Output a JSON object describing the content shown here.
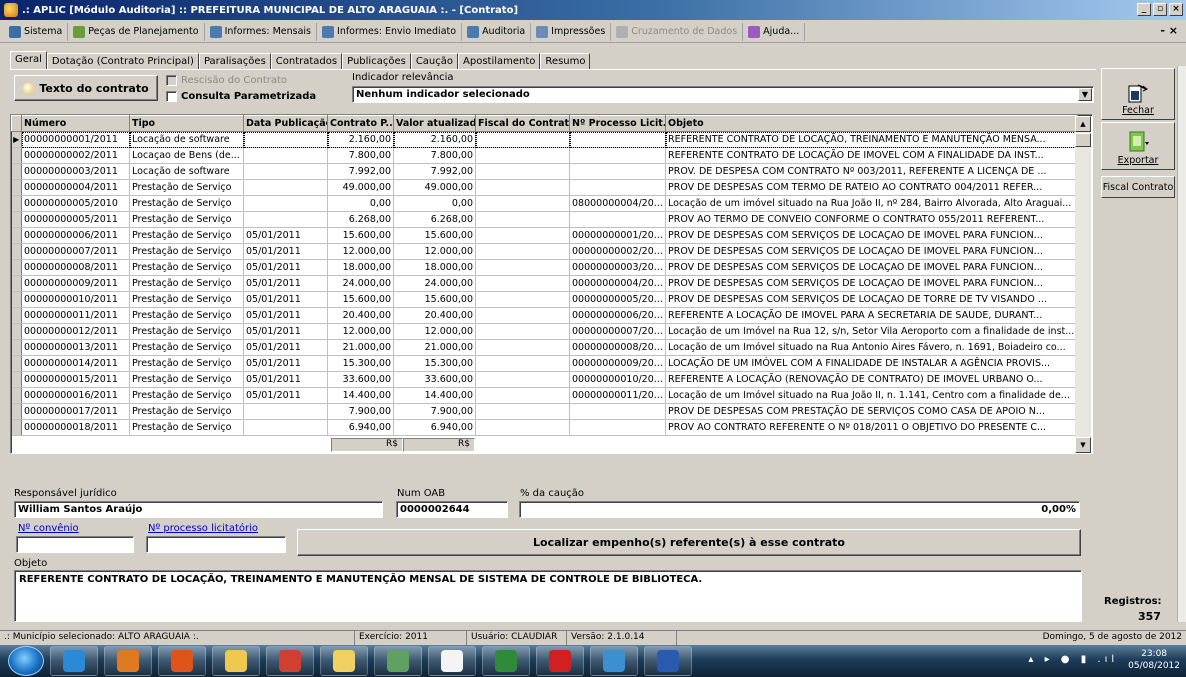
{
  "window": {
    "title": ".: APLIC [Módulo Auditoria] :: PREFEITURA MUNICIPAL DE ALTO ARAGUAIA :. - [Contrato]",
    "min": "_",
    "max": "▫",
    "close": "×"
  },
  "menu": [
    {
      "label": "Sistema",
      "icon": "system-icon",
      "color": "#3a6ea5"
    },
    {
      "label": "Peças de Planejamento",
      "icon": "planning-icon",
      "color": "#6a9a3a"
    },
    {
      "label": "Informes: Mensais",
      "icon": "report-icon",
      "color": "#4a7ab0"
    },
    {
      "label": "Informes: Envio Imediato",
      "icon": "report-icon",
      "color": "#4a7ab0"
    },
    {
      "label": "Auditoria",
      "icon": "audit-icon",
      "color": "#4a7ab0"
    },
    {
      "label": "Impressões",
      "icon": "printer-icon",
      "color": "#6a8ab8"
    },
    {
      "label": "Cruzamento de Dados",
      "icon": "data-cross-icon",
      "color": "#b0b0b0",
      "disabled": true
    },
    {
      "label": "Ajuda...",
      "icon": "help-icon",
      "color": "#9a5ac0"
    }
  ],
  "mdi_close": "- ×",
  "tabs": [
    "Geral",
    "Dotação (Contrato Principal)",
    "Paralisações",
    "Contratados",
    "Publicações",
    "Caução",
    "Apostilamento",
    "Resumo"
  ],
  "top": {
    "texto_button": "Texto do contrato",
    "rescisao_label": "Rescisão do Contrato",
    "consulta_label": "Consulta Parametrizada",
    "indicador_label": "Indicador relevância",
    "indicador_value": "Nenhum indicador selecionado"
  },
  "grid": {
    "columns": [
      "Número",
      "Tipo",
      "Data Publicação",
      "Contrato P...",
      "Valor atualizado",
      "Fiscal do Contrato",
      "Nº Processo Licit...",
      "Objeto"
    ],
    "rows": [
      [
        "00000000001/2011",
        "Locação de software",
        "",
        "2.160,00",
        "2.160,00",
        "",
        "",
        "REFERENTE CONTRATO DE LOCAÇÃO, TREINAMENTO E MANUTENÇÃO MENSA..."
      ],
      [
        "00000000002/2011",
        "Locaçao de Bens (de...",
        "",
        "7.800,00",
        "7.800,00",
        "",
        "",
        "REFERENTE CONTRATO DE LOCAÇÃO DE IMOVEL COM A FINALIDADE DA INST..."
      ],
      [
        "00000000003/2011",
        "Locação de software",
        "",
        "7.992,00",
        "7.992,00",
        "",
        "",
        "PROV. DE DESPESA COM CONTRATO Nº 003/2011, REFERENTE A LICENÇA DE ..."
      ],
      [
        "00000000004/2011",
        "Prestação de Serviço",
        "",
        "49.000,00",
        "49.000,00",
        "",
        "",
        "PROV DE DESPESAS COM TERMO DE RATEIO AO CONTRATO 004/2011 REFER..."
      ],
      [
        "00000000005/2010",
        "Prestação de Serviço",
        "",
        "0,00",
        "0,00",
        "",
        "08000000004/20...",
        "Locação de um imóvel situado na Rua João II, nº 284, Bairro Alvorada, Alto Araguai..."
      ],
      [
        "00000000005/2011",
        "Prestação de Serviço",
        "",
        "6.268,00",
        "6.268,00",
        "",
        "",
        "PROV AO TERMO DE CONVEIO CONFORME O CONTRATO 055/2011 REFERENT..."
      ],
      [
        "00000000006/2011",
        "Prestação de Serviço",
        "05/01/2011",
        "15.600,00",
        "15.600,00",
        "",
        "00000000001/20...",
        "PROV DE DESPESAS COM SERVIÇOS DE LOCAÇAO DE IMOVEL PARA FUNCION..."
      ],
      [
        "00000000007/2011",
        "Prestação de Serviço",
        "05/01/2011",
        "12.000,00",
        "12.000,00",
        "",
        "00000000002/20...",
        "PROV DE DESPESAS COM SERVIÇOS DE LOCAÇAO DE IMOVEL PARA FUNCION..."
      ],
      [
        "00000000008/2011",
        "Prestação de Serviço",
        "05/01/2011",
        "18.000,00",
        "18.000,00",
        "",
        "00000000003/20...",
        "PROV DE DESPESAS COM SERVIÇOS DE LOCAÇAO DE IMOVEL PARA FUNCION..."
      ],
      [
        "00000000009/2011",
        "Prestação de Serviço",
        "05/01/2011",
        "24.000,00",
        "24.000,00",
        "",
        "00000000004/20...",
        "PROV DE DESPESAS COM SERVIÇOS DE LOCAÇAO DE IMOVEL PARA FUNCION..."
      ],
      [
        "00000000010/2011",
        "Prestação de Serviço",
        "05/01/2011",
        "15.600,00",
        "15.600,00",
        "",
        "00000000005/20...",
        "PROV DE DESPESAS COM SERVIÇOS DE LOCAÇAO DE TORRE DE TV VISANDO ..."
      ],
      [
        "00000000011/2011",
        "Prestação de Serviço",
        "05/01/2011",
        "20.400,00",
        "20.400,00",
        "",
        "00000000006/20...",
        "REFERENTE A LOCAÇÃO DE IMOVEL PARA A SECRETARIA DE SAUDE, DURANT..."
      ],
      [
        "00000000012/2011",
        "Prestação de Serviço",
        "05/01/2011",
        "12.000,00",
        "12.000,00",
        "",
        "00000000007/20...",
        "Locação de um Imóvel na Rua 12, s/n, Setor Vila Aeroporto com a finalidade de inst..."
      ],
      [
        "00000000013/2011",
        "Prestação de Serviço",
        "05/01/2011",
        "21.000,00",
        "21.000,00",
        "",
        "00000000008/20...",
        "Locação de um Imóvel situado na Rua Antonio Aires Fávero, n. 1691, Boiadeiro co..."
      ],
      [
        "00000000014/2011",
        "Prestação de Serviço",
        "05/01/2011",
        "15.300,00",
        "15.300,00",
        "",
        "00000000009/20...",
        "LOCAÇÃO DE UM IMÓVEL COM A FINALIDADE DE INSTALAR A AGÊNCIA PROVIS..."
      ],
      [
        "00000000015/2011",
        "Prestação de Serviço",
        "05/01/2011",
        "33.600,00",
        "33.600,00",
        "",
        "00000000010/20...",
        "REFERENTE A LOCAÇÃO (RENOVAÇÃO DE CONTRATO) DE IMOVEL URBANO O..."
      ],
      [
        "00000000016/2011",
        "Prestação de Serviço",
        "05/01/2011",
        "14.400,00",
        "14.400,00",
        "",
        "00000000011/20...",
        "Locação de um Imóvel situado na Rua João II, n. 1.141, Centro com a finalidade de..."
      ],
      [
        "00000000017/2011",
        "Prestação de Serviço",
        "",
        "7.900,00",
        "7.900,00",
        "",
        "",
        "PROV DE DESPESAS COM PRESTAÇÃO DE SERVIÇOS COMO CASA DE APOIO N..."
      ],
      [
        "00000000018/2011",
        "Prestação de Serviço",
        "",
        "6.940,00",
        "6.940,00",
        "",
        "",
        "PROV AO CONTRATO REFERENTE O Nº 018/2011 O OBJETIVO DO PRESENTE C..."
      ]
    ],
    "total_contrato": "R$",
    "total_valor": "R$"
  },
  "right": {
    "fechar": "Fechar",
    "exportar": "Exportar",
    "fiscal": "Fiscal Contrato",
    "registros_label": "Registros:",
    "registros_value": "357"
  },
  "form": {
    "responsavel_label": "Responsável jurídico",
    "responsavel_value": "William Santos Araújo",
    "oab_label": "Num OAB",
    "oab_value": "0000002644",
    "caucao_label": "% da caução",
    "caucao_value": "0,00%",
    "convenio_label": "Nº convênio",
    "convenio_value": "",
    "processo_label": "Nº processo licitatório",
    "processo_value": "",
    "localizar_button": "Localizar empenho(s) referente(s) à esse contrato",
    "objeto_label": "Objeto",
    "objeto_value": "REFERENTE CONTRATO DE LOCAÇÃO, TREINAMENTO E MANUTENÇÃO MENSAL DE SISTEMA DE CONTROLE DE BIBLIOTECA."
  },
  "status": {
    "municipio": ".: Município selecionado: ALTO ARAGUAIA :.",
    "exercicio": "Exercício: 2011",
    "usuario": "Usuário: CLAUDIAR",
    "versao": "Versão: 2.1.0.14",
    "data": "Domingo, 5 de agosto de 2012"
  },
  "taskbar": {
    "apps": [
      {
        "name": "internet-explorer-icon",
        "color": "#2a8ad8"
      },
      {
        "name": "outlook-icon",
        "color": "#e07a20"
      },
      {
        "name": "firefox-icon",
        "color": "#e0541a"
      },
      {
        "name": "file-explorer-icon",
        "color": "#f0c850"
      },
      {
        "name": "chrome-icon",
        "color": "#d04030"
      },
      {
        "name": "folder-icon",
        "color": "#f0d060"
      },
      {
        "name": "tools-icon",
        "color": "#60a060"
      },
      {
        "name": "document-icon",
        "color": "#f4f4f4"
      },
      {
        "name": "excel-icon",
        "color": "#2f8a3a"
      },
      {
        "name": "pdf-icon",
        "color": "#d02020"
      },
      {
        "name": "globe-icon",
        "color": "#3a90d0"
      },
      {
        "name": "word-icon",
        "color": "#2a5ab0"
      }
    ],
    "time": "23:08",
    "date": "05/08/2012"
  }
}
